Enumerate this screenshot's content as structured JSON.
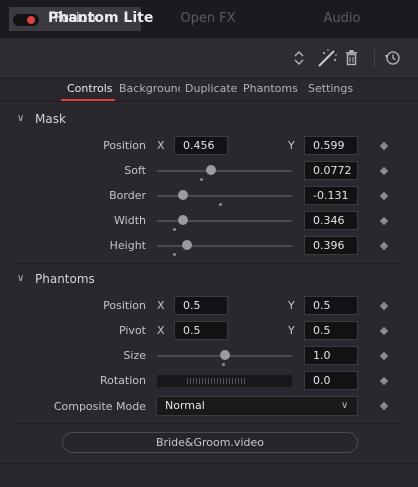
{
  "top_tabs": [
    {
      "label": "Fusion",
      "active": true
    },
    {
      "label": "Open FX",
      "active": false
    },
    {
      "label": "Audio",
      "active": false
    }
  ],
  "header": {
    "title": "Phantom Lite",
    "enabled": true,
    "icons": [
      "up-down-arrows-icon",
      "magic-wand-icon",
      "trash-icon",
      "history-icon"
    ]
  },
  "subtabs": [
    "Controls",
    "Background",
    "Duplicate",
    "Phantoms",
    "Settings"
  ],
  "mask": {
    "title": "Mask",
    "position": {
      "label": "Position",
      "x_label": "X",
      "x": "0.456",
      "y_label": "Y",
      "y": "0.599"
    },
    "soft": {
      "label": "Soft",
      "value": "0.0772",
      "level": 0.4
    },
    "border": {
      "label": "Border",
      "value": "-0.131",
      "level": 0.19
    },
    "width": {
      "label": "Width",
      "value": "0.346",
      "level": 0.19
    },
    "height": {
      "label": "Height",
      "value": "0.396",
      "level": 0.22
    }
  },
  "phantoms": {
    "title": "Phantoms",
    "position": {
      "label": "Position",
      "x_label": "X",
      "x": "0.5",
      "y_label": "Y",
      "y": "0.5"
    },
    "pivot": {
      "label": "Pivot",
      "x_label": "X",
      "x": "0.5",
      "y_label": "Y",
      "y": "0.5"
    },
    "size": {
      "label": "Size",
      "value": "1.0",
      "level": 0.5
    },
    "rotation": {
      "label": "Rotation",
      "value": "0.0"
    },
    "composite": {
      "label": "Composite Mode",
      "value": "Normal"
    }
  },
  "source_button": "Bride&Groom.video",
  "colors": {
    "accent": "#e0413c",
    "background": "#28282e",
    "field": "#121215"
  }
}
